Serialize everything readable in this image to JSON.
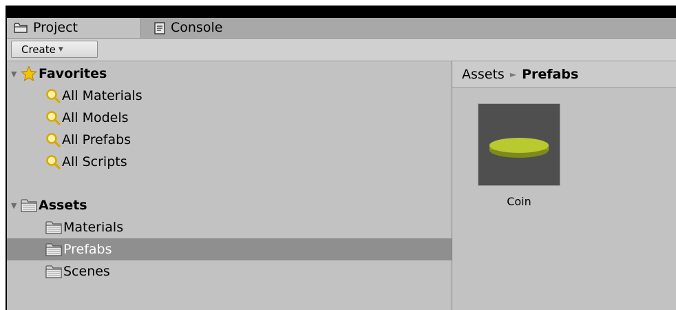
{
  "tabs": [
    {
      "label": "Project",
      "icon": "folder-icon",
      "active": true
    },
    {
      "label": "Console",
      "icon": "console-icon",
      "active": false
    }
  ],
  "toolbar": {
    "create_label": "Create",
    "create_caret": "▼"
  },
  "tree": {
    "favorites": {
      "label": "Favorites",
      "items": [
        "All Materials",
        "All Models",
        "All Prefabs",
        "All Scripts"
      ]
    },
    "assets": {
      "label": "Assets",
      "items": [
        "Materials",
        "Prefabs",
        "Scenes"
      ],
      "selected": "Prefabs"
    }
  },
  "breadcrumb": {
    "root": "Assets",
    "separator": "►",
    "current": "Prefabs"
  },
  "assets_grid": [
    {
      "name": "Coin",
      "color": "#b9c930"
    }
  ],
  "colors": {
    "selection": "#8f8f8f",
    "coin": "#b9c930"
  }
}
